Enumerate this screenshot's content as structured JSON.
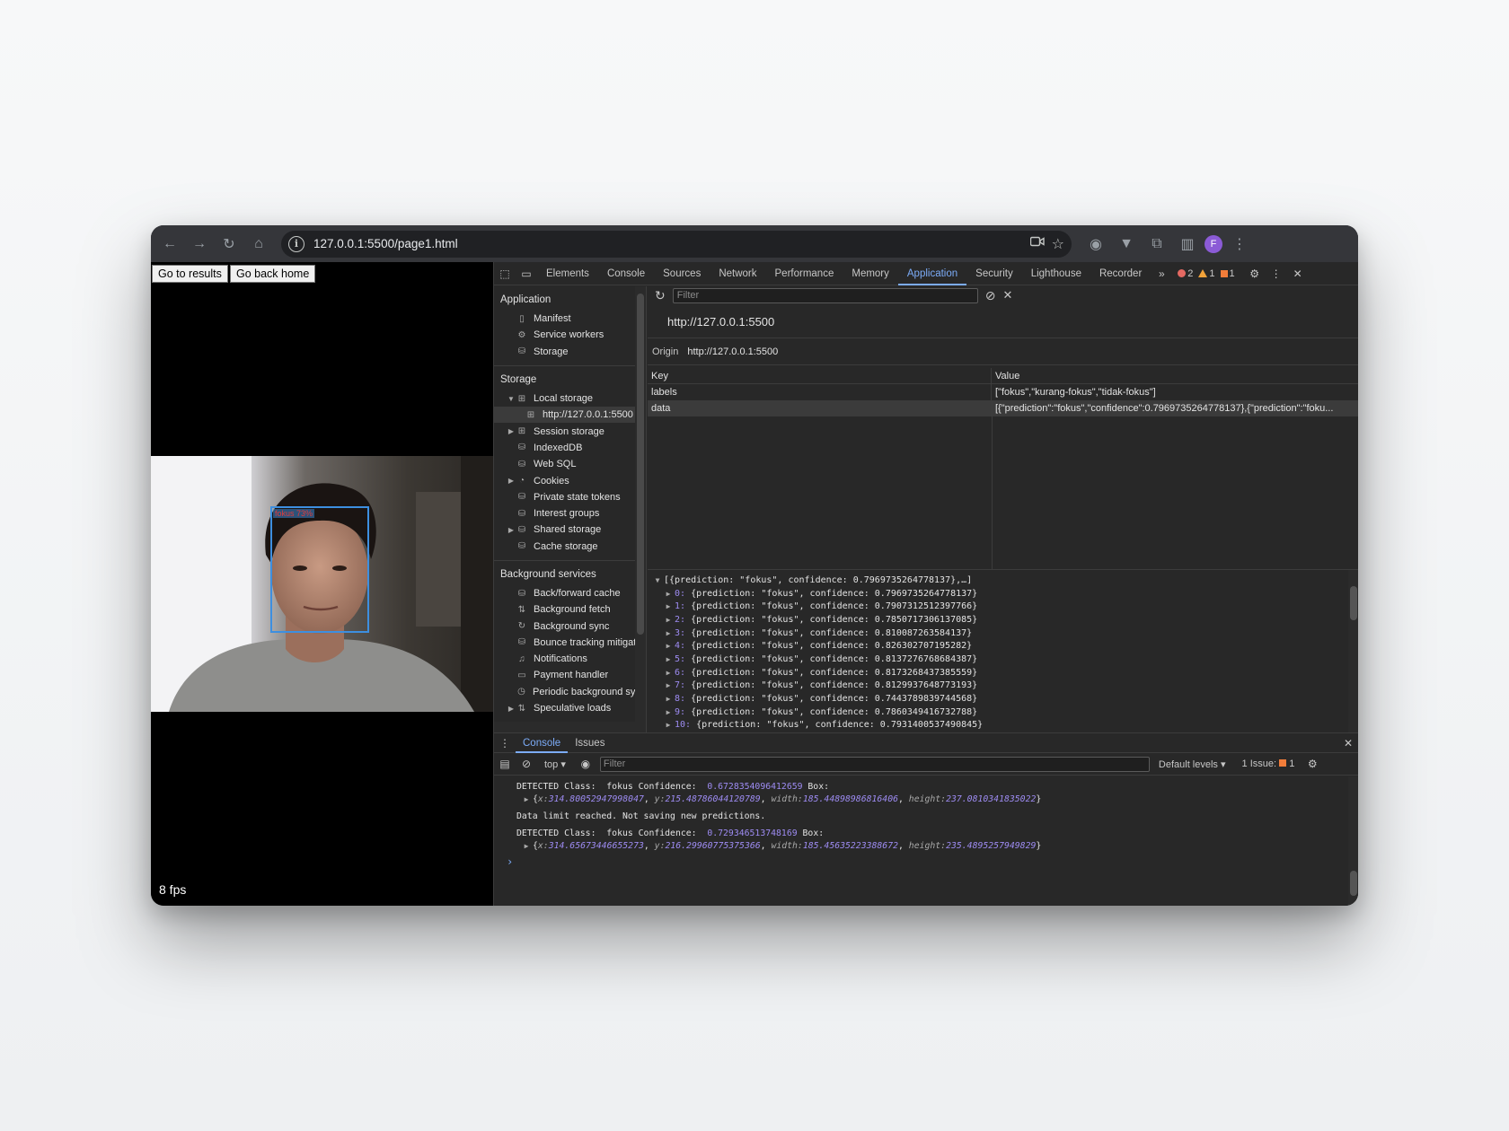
{
  "browser": {
    "url": "127.0.0.1:5500/page1.html",
    "avatar_initial": "F"
  },
  "page": {
    "btn_results": "Go to results",
    "btn_home": "Go back home",
    "bbox_label": "fokus 73%",
    "fps": "8 fps"
  },
  "devtools": {
    "tabs": [
      "Elements",
      "Console",
      "Sources",
      "Network",
      "Performance",
      "Memory",
      "Application",
      "Security",
      "Lighthouse",
      "Recorder"
    ],
    "active_tab": "Application",
    "errors": "2",
    "warnings": "1",
    "issues": "1",
    "sidebar": {
      "application_title": "Application",
      "application_items": [
        "Manifest",
        "Service workers",
        "Storage"
      ],
      "storage_title": "Storage",
      "local_storage": "Local storage",
      "local_storage_child": "http://127.0.0.1:5500",
      "storage_items": [
        "Session storage",
        "IndexedDB",
        "Web SQL",
        "Cookies",
        "Private state tokens",
        "Interest groups",
        "Shared storage",
        "Cache storage"
      ],
      "background_title": "Background services",
      "background_items": [
        "Back/forward cache",
        "Background fetch",
        "Background sync",
        "Bounce tracking mitigatio",
        "Notifications",
        "Payment handler",
        "Periodic background sync",
        "Speculative loads"
      ]
    },
    "main": {
      "filter_placeholder": "Filter",
      "origin_title": "http://127.0.0.1:5500",
      "origin_label": "Origin",
      "origin_value": "http://127.0.0.1:5500",
      "col_key": "Key",
      "col_value": "Value",
      "rows": [
        {
          "key": "labels",
          "value": "[\"fokus\",\"kurang-fokus\",\"tidak-fokus\"]"
        },
        {
          "key": "data",
          "value": "[{\"prediction\":\"fokus\",\"confidence\":0.7969735264778137},{\"prediction\":\"foku..."
        }
      ],
      "preview_header": "[{prediction: \"fokus\", confidence: 0.7969735264778137},…]",
      "preview_items": [
        {
          "idx": "0:",
          "text": "{prediction: \"fokus\", confidence: 0.7969735264778137}"
        },
        {
          "idx": "1:",
          "text": "{prediction: \"fokus\", confidence: 0.7907312512397766}"
        },
        {
          "idx": "2:",
          "text": "{prediction: \"fokus\", confidence: 0.7850717306137085}"
        },
        {
          "idx": "3:",
          "text": "{prediction: \"fokus\", confidence: 0.810087263584137}"
        },
        {
          "idx": "4:",
          "text": "{prediction: \"fokus\", confidence: 0.826302707195282}"
        },
        {
          "idx": "5:",
          "text": "{prediction: \"fokus\", confidence: 0.8137276768684387}"
        },
        {
          "idx": "6:",
          "text": "{prediction: \"fokus\", confidence: 0.8173268437385559}"
        },
        {
          "idx": "7:",
          "text": "{prediction: \"fokus\", confidence: 0.8129937648773193}"
        },
        {
          "idx": "8:",
          "text": "{prediction: \"fokus\", confidence: 0.7443789839744568}"
        },
        {
          "idx": "9:",
          "text": "{prediction: \"fokus\", confidence: 0.7860349416732788}"
        },
        {
          "idx": "10:",
          "text": "{prediction: \"fokus\", confidence: 0.7931400537490845}"
        }
      ]
    },
    "drawer": {
      "tab_console": "Console",
      "tab_issues": "Issues",
      "context": "top",
      "filter_placeholder": "Filter",
      "levels": "Default levels",
      "issue_count": "1 Issue:",
      "issue_num": "1",
      "logs": {
        "l1_prefix": "DETECTED Class:  fokus Confidence:  ",
        "l1_num": "0.6728354096412659",
        "l1_suffix": " Box:",
        "l1_x": "314.80052947998047",
        "l1_y": "215.48786044120789",
        "l1_w": "185.44898986816406",
        "l1_h": "237.0810341835022",
        "l2": "Data limit reached. Not saving new predictions.",
        "l3_prefix": "DETECTED Class:  fokus Confidence:  ",
        "l3_num": "0.729346513748169",
        "l3_suffix": " Box:",
        "l3_x": "314.65673446655273",
        "l3_y": "216.29960775375366",
        "l3_w": "185.45635223388672",
        "l3_h": "235.4895257949829"
      }
    }
  }
}
